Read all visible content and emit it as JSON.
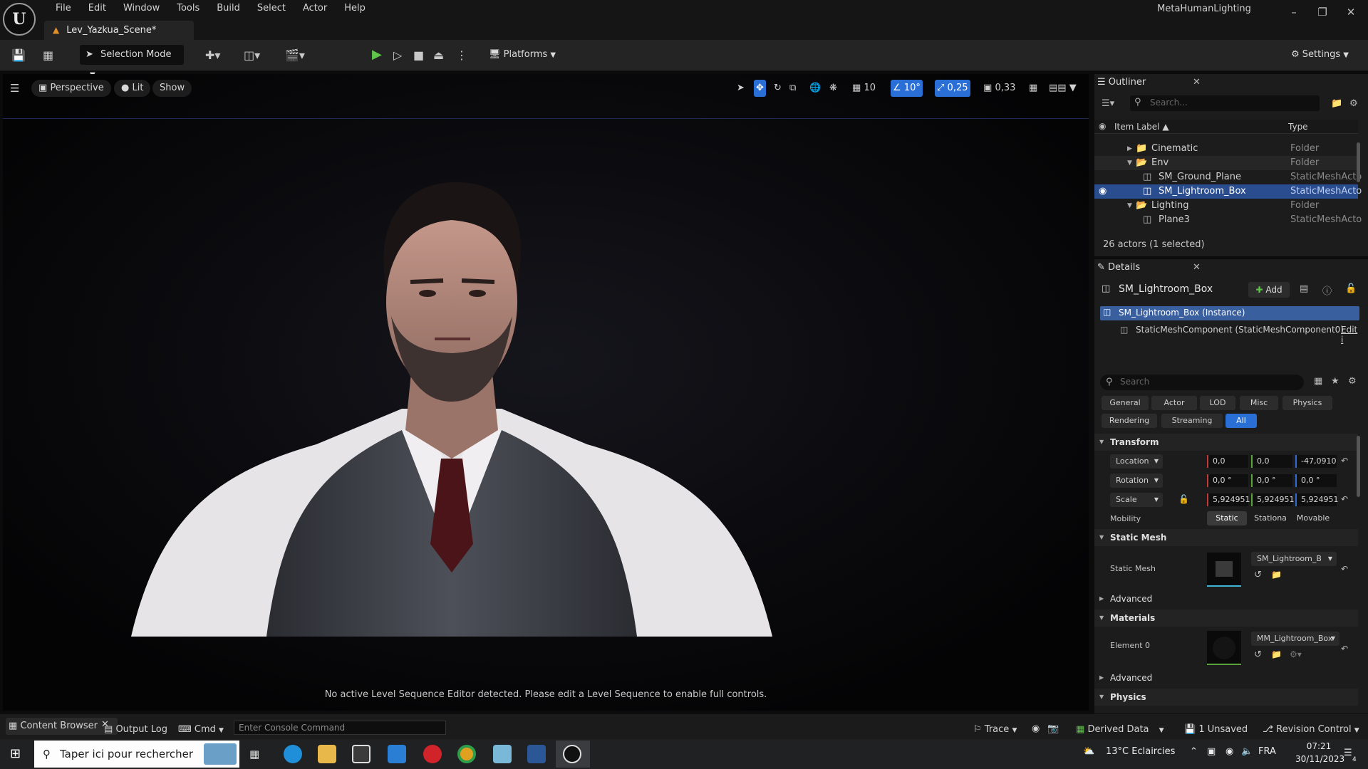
{
  "app": {
    "project_name": "MetaHumanLighting",
    "logo_text": "U",
    "menu": [
      "File",
      "Edit",
      "Window",
      "Tools",
      "Build",
      "Select",
      "Actor",
      "Help"
    ],
    "level_tab": "Lev_Yazkua_Scene*"
  },
  "toolbar": {
    "selection_mode": "Selection Mode",
    "platforms": "Platforms",
    "settings": "Settings"
  },
  "viewport": {
    "perspective": "Perspective",
    "lit": "Lit",
    "show": "Show",
    "grid_snap": "10",
    "rotation_snap": "10°",
    "scale_snap": "0,25",
    "camera_speed": "0,33",
    "message": "No active Level Sequence Editor detected. Please edit a Level Sequence to enable full controls."
  },
  "outliner": {
    "title": "Outliner",
    "search_placeholder": "Search...",
    "col_label": "Item Label",
    "col_type": "Type",
    "rows": [
      {
        "label": "Cinematic",
        "type": "Folder"
      },
      {
        "label": "Env",
        "type": "Folder"
      },
      {
        "label": "SM_Ground_Plane",
        "type": "StaticMeshActo"
      },
      {
        "label": "SM_Lightroom_Box",
        "type": "StaticMeshActo"
      },
      {
        "label": "Lighting",
        "type": "Folder"
      },
      {
        "label": "Plane3",
        "type": "StaticMeshActo"
      }
    ],
    "status": "26 actors (1 selected)"
  },
  "details": {
    "title": "Details",
    "actor_name": "SM_Lightroom_Box",
    "add_label": "Add",
    "instance_label": "SM_Lightroom_Box (Instance)",
    "component_label": "StaticMeshComponent (StaticMeshComponent0)",
    "edit_link": "Edit i",
    "search_placeholder": "Search",
    "filters": [
      "General",
      "Actor",
      "LOD",
      "Misc",
      "Physics",
      "Rendering",
      "Streaming",
      "All"
    ],
    "transform": {
      "section": "Transform",
      "location_label": "Location",
      "location": [
        "0,0",
        "0,0",
        "-47,0910"
      ],
      "rotation_label": "Rotation",
      "rotation": [
        "0,0 °",
        "0,0 °",
        "0,0 °"
      ],
      "scale_label": "Scale",
      "scale": [
        "5,924951",
        "5,924951",
        "5,924951"
      ],
      "mobility_label": "Mobility",
      "mobility": [
        "Static",
        "Stationa",
        "Movable"
      ]
    },
    "static_mesh": {
      "section": "Static Mesh",
      "label": "Static Mesh",
      "value": "SM_Lightroom_B",
      "advanced": "Advanced"
    },
    "materials": {
      "section": "Materials",
      "label": "Element 0",
      "value": "MM_Lightroom_Box",
      "advanced": "Advanced"
    },
    "physics_section": "Physics"
  },
  "bottombar": {
    "content_browser": "Content Browser",
    "output_log": "Output Log",
    "cmd": "Cmd",
    "console_placeholder": "Enter Console Command",
    "trace": "Trace",
    "derived_data": "Derived Data",
    "unsaved": "1 Unsaved",
    "revision_control": "Revision Control"
  },
  "taskbar": {
    "search_placeholder": "Taper ici pour rechercher",
    "weather": "13°C  Eclaircies",
    "lang": "FRA",
    "time": "07:21",
    "date": "30/11/2023",
    "notif_count": "4"
  },
  "colors": {
    "accent": "#2a6fd6",
    "play": "#5ec44a",
    "folder": "#d7b26a",
    "selection": "#2a4d8f"
  }
}
